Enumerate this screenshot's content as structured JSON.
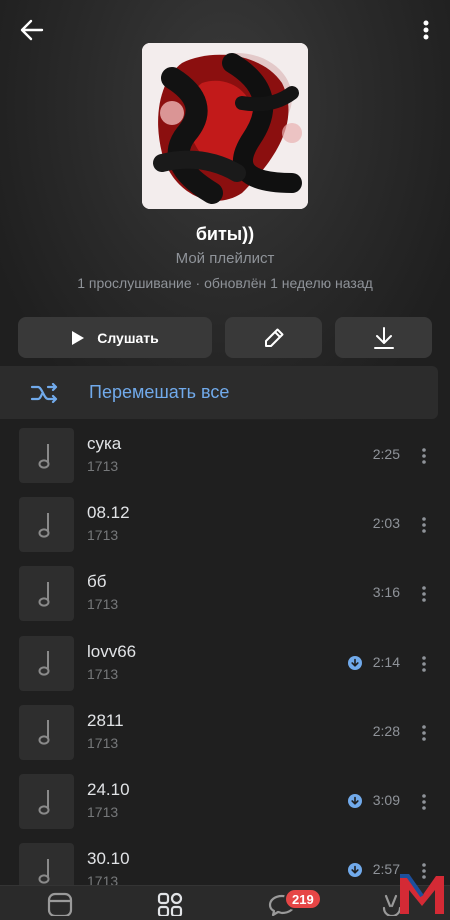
{
  "header": {
    "back_icon": "arrow-left-icon",
    "more_icon": "more-vertical-icon"
  },
  "playlist": {
    "title": "биты))",
    "subtitle": "Мой плейлист",
    "meta": "1 прослушивание · обновлён 1 неделю назад"
  },
  "actions": {
    "listen_label": "Слушать",
    "edit_icon": "pencil-icon",
    "download_icon": "download-icon"
  },
  "shuffle": {
    "label": "Перемешать все",
    "icon": "shuffle-icon"
  },
  "colors": {
    "accent": "#71aaeb",
    "background": "#1f1f1f",
    "button": "#393939",
    "badge": "#e64646"
  },
  "tracks": [
    {
      "title": "сука",
      "artist": "1713",
      "duration": "2:25",
      "downloaded": false
    },
    {
      "title": "08.12",
      "artist": "1713",
      "duration": "2:03",
      "downloaded": false
    },
    {
      "title": "бб",
      "artist": "1713",
      "duration": "3:16",
      "downloaded": false
    },
    {
      "title": "lovv66",
      "artist": "1713",
      "duration": "2:14",
      "downloaded": true
    },
    {
      "title": "2811",
      "artist": "1713",
      "duration": "2:28",
      "downloaded": false
    },
    {
      "title": "24.10",
      "artist": "1713",
      "duration": "3:09",
      "downloaded": true
    },
    {
      "title": "30.10",
      "artist": "1713",
      "duration": "2:57",
      "downloaded": true
    }
  ],
  "tabbar": {
    "messages_badge": "219",
    "tabs": [
      "newsfeed-icon",
      "services-icon",
      "messages-icon",
      "clips-icon"
    ]
  }
}
